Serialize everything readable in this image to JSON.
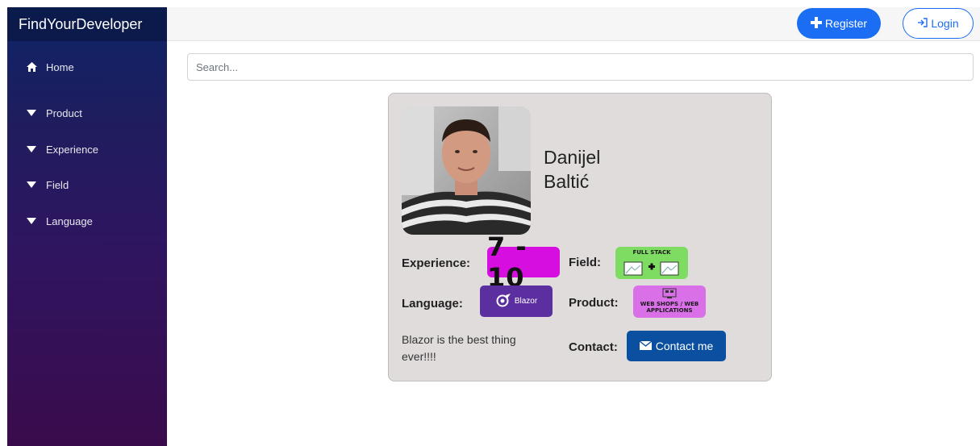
{
  "sidebar": {
    "brand": "FindYourDeveloper",
    "home_label": "Home",
    "items": [
      {
        "label": "Product"
      },
      {
        "label": "Experience"
      },
      {
        "label": "Field"
      },
      {
        "label": "Language"
      }
    ]
  },
  "header": {
    "register_label": "Register",
    "login_label": "Login"
  },
  "search": {
    "placeholder": "Search..."
  },
  "profile": {
    "first_name": "Danijel",
    "last_name": "Baltić",
    "experience_label": "Experience:",
    "experience_value": "7 - 10",
    "field_label": "Field:",
    "field_badge_title": "FULL STACK",
    "language_label": "Language:",
    "language_badge": "Blazor",
    "product_label": "Product:",
    "product_badge": "WEB SHOPS / WEB APPLICATIONS",
    "description": "Blazor is the best thing ever!!!!",
    "contact_label": "Contact:",
    "contact_button": "Contact me"
  },
  "colors": {
    "accent": "#1b6ef3",
    "contact_button": "#0b4fa0",
    "experience_badge": "#d60ee0",
    "field_badge": "#7fdc63",
    "language_badge": "#5b2fa0",
    "product_badge": "#d970e8",
    "card_bg": "#e1dcdc"
  },
  "icons": {
    "home": "home-icon",
    "nav_items": "caret-down-icon",
    "register": "plus-icon",
    "login": "sign-in-icon",
    "contact": "envelope-icon"
  }
}
